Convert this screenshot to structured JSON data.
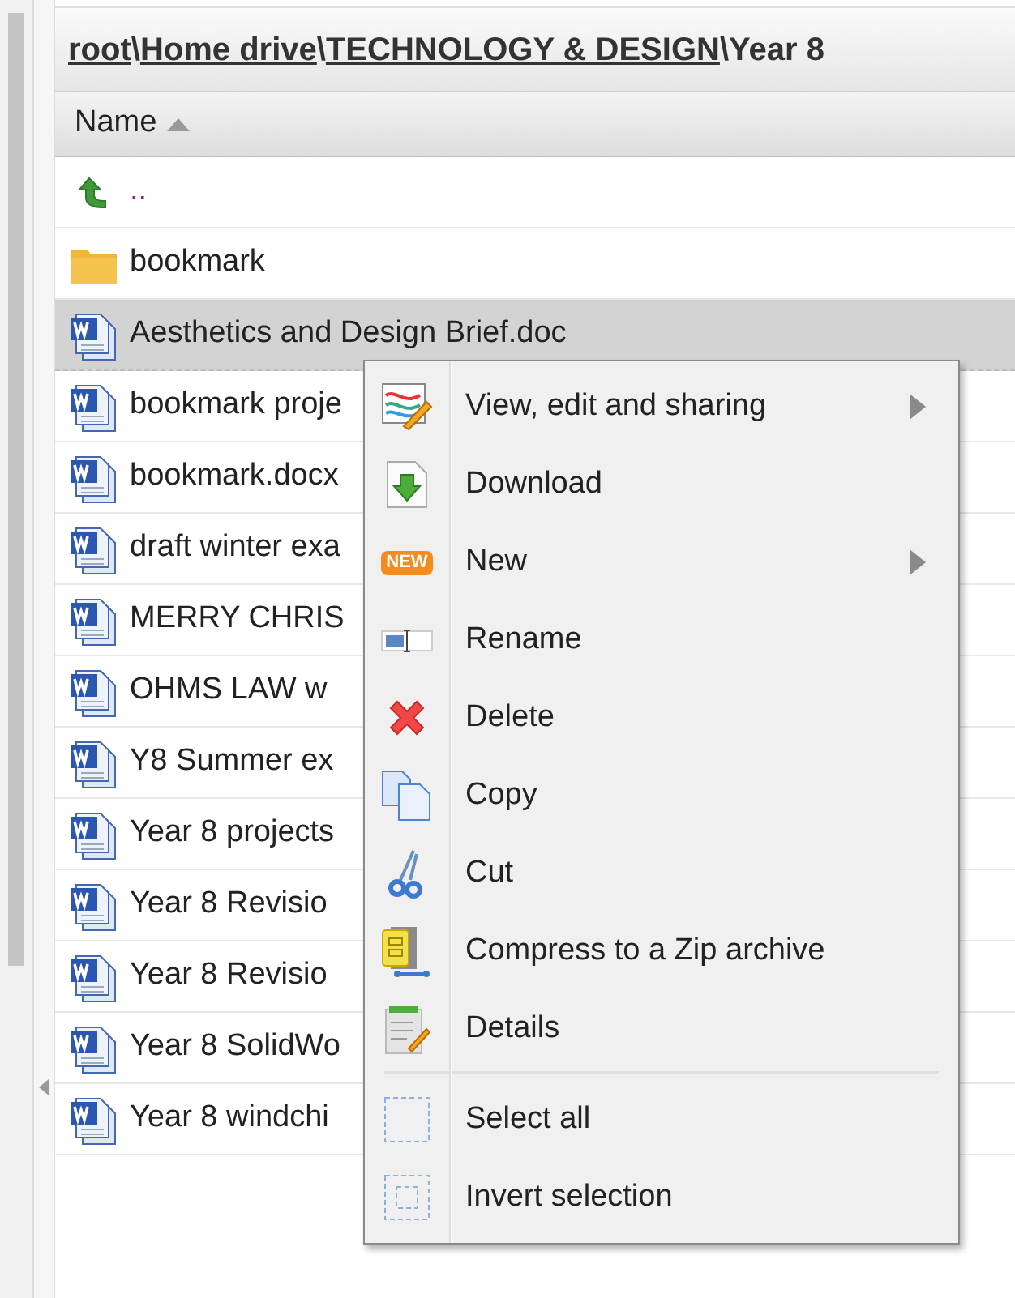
{
  "breadcrumb": [
    {
      "kind": "link",
      "label": "root"
    },
    {
      "kind": "separator",
      "label": "\\"
    },
    {
      "kind": "link",
      "label": "Home drive"
    },
    {
      "kind": "separator",
      "label": "\\"
    },
    {
      "kind": "link",
      "label": "TECHNOLOGY & DESIGN"
    },
    {
      "kind": "separator",
      "label": "\\"
    },
    {
      "kind": "current",
      "label": "Year 8"
    }
  ],
  "table": {
    "columns": [
      {
        "label": "Name",
        "sort_ascending": true
      }
    ],
    "rows": [
      {
        "kind": "up",
        "name": "..",
        "selected": false
      },
      {
        "kind": "folder",
        "name": "bookmark",
        "selected": false
      },
      {
        "kind": "doc",
        "name": "Aesthetics and Design Brief.doc",
        "selected": true
      },
      {
        "kind": "doc",
        "name": "bookmark proje",
        "selected": false
      },
      {
        "kind": "doc",
        "name": "bookmark.docx",
        "selected": false
      },
      {
        "kind": "doc",
        "name": "draft winter exa",
        "selected": false
      },
      {
        "kind": "doc",
        "name": "MERRY CHRIS",
        "selected": false
      },
      {
        "kind": "doc",
        "name": "OHMS LAW w",
        "selected": false
      },
      {
        "kind": "doc",
        "name": "Y8 Summer ex",
        "selected": false
      },
      {
        "kind": "doc",
        "name": "Year 8 projects",
        "selected": false
      },
      {
        "kind": "doc",
        "name": "Year 8 Revisio",
        "selected": false
      },
      {
        "kind": "doc",
        "name": "Year 8 Revisio",
        "selected": false
      },
      {
        "kind": "doc",
        "name": "Year 8 SolidWo",
        "selected": false
      },
      {
        "kind": "doc",
        "name": "Year 8 windchi",
        "selected": false
      }
    ]
  },
  "context_menu": {
    "groups": [
      [
        {
          "kind": "view",
          "label": "View, edit and sharing",
          "submenu": true
        },
        {
          "kind": "download",
          "label": "Download",
          "submenu": false
        },
        {
          "kind": "new",
          "label": "New",
          "submenu": true,
          "badge": "NEW"
        },
        {
          "kind": "rename",
          "label": "Rename",
          "submenu": false
        },
        {
          "kind": "delete",
          "label": "Delete",
          "submenu": false
        },
        {
          "kind": "copy",
          "label": "Copy",
          "submenu": false
        },
        {
          "kind": "cut",
          "label": "Cut",
          "submenu": false
        },
        {
          "kind": "zip",
          "label": "Compress to a Zip archive",
          "submenu": false
        },
        {
          "kind": "details",
          "label": "Details",
          "submenu": false
        }
      ],
      [
        {
          "kind": "selectall",
          "label": "Select all",
          "submenu": false
        },
        {
          "kind": "invert",
          "label": "Invert selection",
          "submenu": false
        }
      ]
    ]
  }
}
